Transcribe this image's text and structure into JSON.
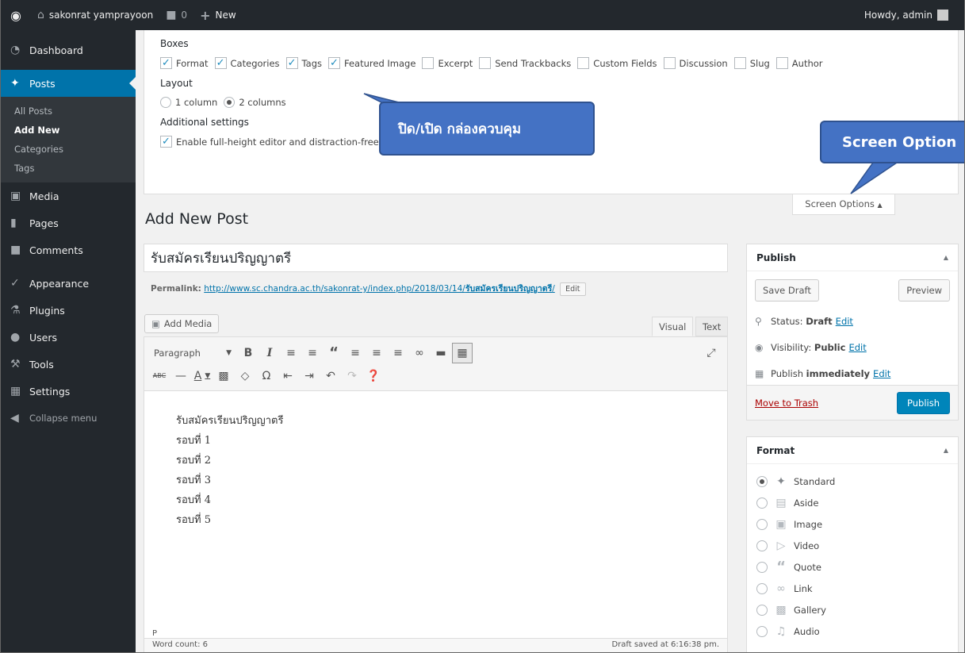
{
  "adminbar": {
    "site_name": "sakonrat yamprayoon",
    "comments_count": "0",
    "new_label": "New",
    "howdy": "Howdy, admin"
  },
  "sidebar": {
    "items": [
      {
        "label": "Dashboard",
        "icon": "dashboard-icon"
      },
      {
        "label": "Posts",
        "icon": "pin-icon"
      },
      {
        "label": "Media",
        "icon": "media-icon"
      },
      {
        "label": "Pages",
        "icon": "pages-icon"
      },
      {
        "label": "Comments",
        "icon": "comment-icon"
      },
      {
        "label": "Appearance",
        "icon": "brush-icon"
      },
      {
        "label": "Plugins",
        "icon": "plugin-icon"
      },
      {
        "label": "Users",
        "icon": "users-icon"
      },
      {
        "label": "Tools",
        "icon": "wrench-icon"
      },
      {
        "label": "Settings",
        "icon": "settings-icon"
      },
      {
        "label": "Collapse menu",
        "icon": "collapse-icon"
      }
    ],
    "posts_sub": [
      "All Posts",
      "Add New",
      "Categories",
      "Tags"
    ]
  },
  "screen_options": {
    "boxes_heading": "Boxes",
    "boxes": [
      {
        "label": "Format",
        "checked": true
      },
      {
        "label": "Categories",
        "checked": true
      },
      {
        "label": "Tags",
        "checked": true
      },
      {
        "label": "Featured Image",
        "checked": true
      },
      {
        "label": "Excerpt",
        "checked": false
      },
      {
        "label": "Send Trackbacks",
        "checked": false
      },
      {
        "label": "Custom Fields",
        "checked": false
      },
      {
        "label": "Discussion",
        "checked": false
      },
      {
        "label": "Slug",
        "checked": false
      },
      {
        "label": "Author",
        "checked": false
      }
    ],
    "layout_heading": "Layout",
    "layout_options": [
      "1 column",
      "2 columns"
    ],
    "layout_selected": "2 columns",
    "additional_heading": "Additional settings",
    "fullheight_label": "Enable full-height editor and distraction-free functionality.",
    "tab_label": "Screen Options"
  },
  "callouts": {
    "thai": "ปิด/เปิด กล่องควบคุม",
    "screen_options": "Screen Option"
  },
  "colors": {
    "accent": "#0073aa",
    "callout": "#4472c4",
    "adminbar": "#23282d"
  },
  "page_title": "Add New Post",
  "post": {
    "title": "รับสมัครเรียนปริญญาตรี",
    "permalink_label": "Permalink:",
    "permalink_base": "http://www.sc.chandra.ac.th/sakonrat-y/index.php/2018/03/14/",
    "permalink_slug": "รับสมัครเรียนปริญญาตรี",
    "permalink_tail": "/",
    "edit_label": "Edit",
    "content_lines": [
      "รับสมัครเรียนปริญญาตรี",
      "รอบที่ 1",
      "รอบที่ 2",
      "รอบที่ 3",
      "รอบที่ 4",
      "รอบที่ 5"
    ]
  },
  "editor": {
    "add_media": "Add Media",
    "tab_visual": "Visual",
    "tab_text": "Text",
    "format_select": "Paragraph",
    "path": "P",
    "word_count": "Word count: 6",
    "draft_saved": "Draft saved at 6:16:38 pm."
  },
  "publish": {
    "title": "Publish",
    "save_draft": "Save Draft",
    "preview": "Preview",
    "status_label": "Status:",
    "status_value": "Draft",
    "visibility_label": "Visibility:",
    "visibility_value": "Public",
    "publish_label": "Publish",
    "publish_value": "immediately",
    "edit": "Edit",
    "trash": "Move to Trash",
    "publish_button": "Publish"
  },
  "format": {
    "title": "Format",
    "options": [
      "Standard",
      "Aside",
      "Image",
      "Video",
      "Quote",
      "Link",
      "Gallery",
      "Audio"
    ],
    "selected": "Standard"
  }
}
